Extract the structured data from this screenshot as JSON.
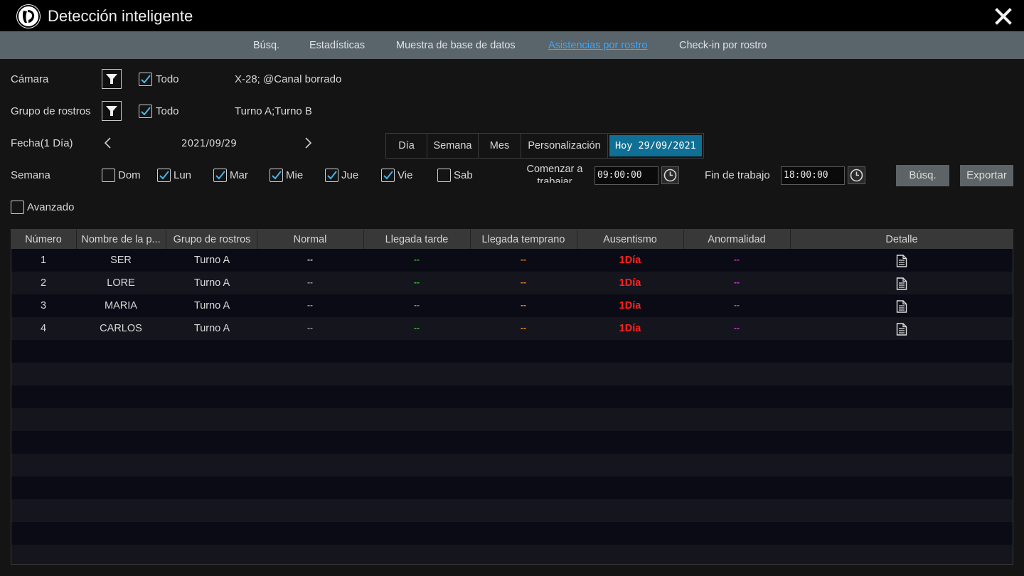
{
  "window": {
    "title": "Detección inteligente",
    "close_icon": "close-icon"
  },
  "tabs": [
    {
      "label": "Búsq.",
      "active": false
    },
    {
      "label": "Estadísticas",
      "active": false
    },
    {
      "label": "Muestra de base de datos",
      "active": false
    },
    {
      "label": "Asistencias por rostro",
      "active": true
    },
    {
      "label": "Check-in por rostro",
      "active": false
    }
  ],
  "filters": {
    "camera": {
      "label": "Cámara",
      "all_label": "Todo",
      "all_checked": true,
      "value": "X-28;  @Canal borrado"
    },
    "face_group": {
      "label": "Grupo de rostros",
      "all_label": "Todo",
      "all_checked": true,
      "value": "Turno A;Turno B"
    },
    "date": {
      "label": "Fecha(1 Día)",
      "value": "2021/09/29"
    },
    "range_buttons": [
      "Día",
      "Semana",
      "Mes",
      "Personalización"
    ],
    "today_button": "Hoy 29/09/2021",
    "week": {
      "label": "Semana",
      "days": [
        {
          "label": "Dom",
          "checked": false
        },
        {
          "label": "Lun",
          "checked": true
        },
        {
          "label": "Mar",
          "checked": true
        },
        {
          "label": "Mie",
          "checked": true
        },
        {
          "label": "Jue",
          "checked": true
        },
        {
          "label": "Vie",
          "checked": true
        },
        {
          "label": "Sab",
          "checked": false
        }
      ]
    },
    "start_work": {
      "label_line1": "Comenzar a",
      "label_line2": "trabajar",
      "value": "09:00:00"
    },
    "end_work": {
      "label": "Fin de trabajo",
      "value": "18:00:00"
    },
    "search_button": "Búsq.",
    "export_button": "Exportar",
    "advanced": {
      "label": "Avanzado",
      "checked": false
    }
  },
  "table": {
    "columns": [
      "Número",
      "Nombre de la p...",
      "Grupo de rostros",
      "Normal",
      "Llegada tarde",
      "Llegada temprano",
      "Ausentismo",
      "Anormalidad",
      "Detalle"
    ],
    "rows": [
      {
        "num": "1",
        "name": "SER",
        "group": "Turno A",
        "normal": "--",
        "late": "--",
        "early": "--",
        "absence": "1Día",
        "abnormal": "--"
      },
      {
        "num": "2",
        "name": "LORE",
        "group": "Turno A",
        "normal": "--",
        "late": "--",
        "early": "--",
        "absence": "1Día",
        "abnormal": "--"
      },
      {
        "num": "3",
        "name": "MARIA",
        "group": "Turno A",
        "normal": "--",
        "late": "--",
        "early": "--",
        "absence": "1Día",
        "abnormal": "--"
      },
      {
        "num": "4",
        "name": "CARLOS",
        "group": "Turno A",
        "normal": "--",
        "late": "--",
        "early": "--",
        "absence": "1Día",
        "abnormal": "--"
      }
    ],
    "detail_icon": "document-icon"
  },
  "colors": {
    "late": "#39c030",
    "early": "#f08c1e",
    "absence": "#ff2020",
    "abnormal": "#d23bd8",
    "active_tab": "#3aa8ff",
    "today_button": "#0f6f95"
  }
}
